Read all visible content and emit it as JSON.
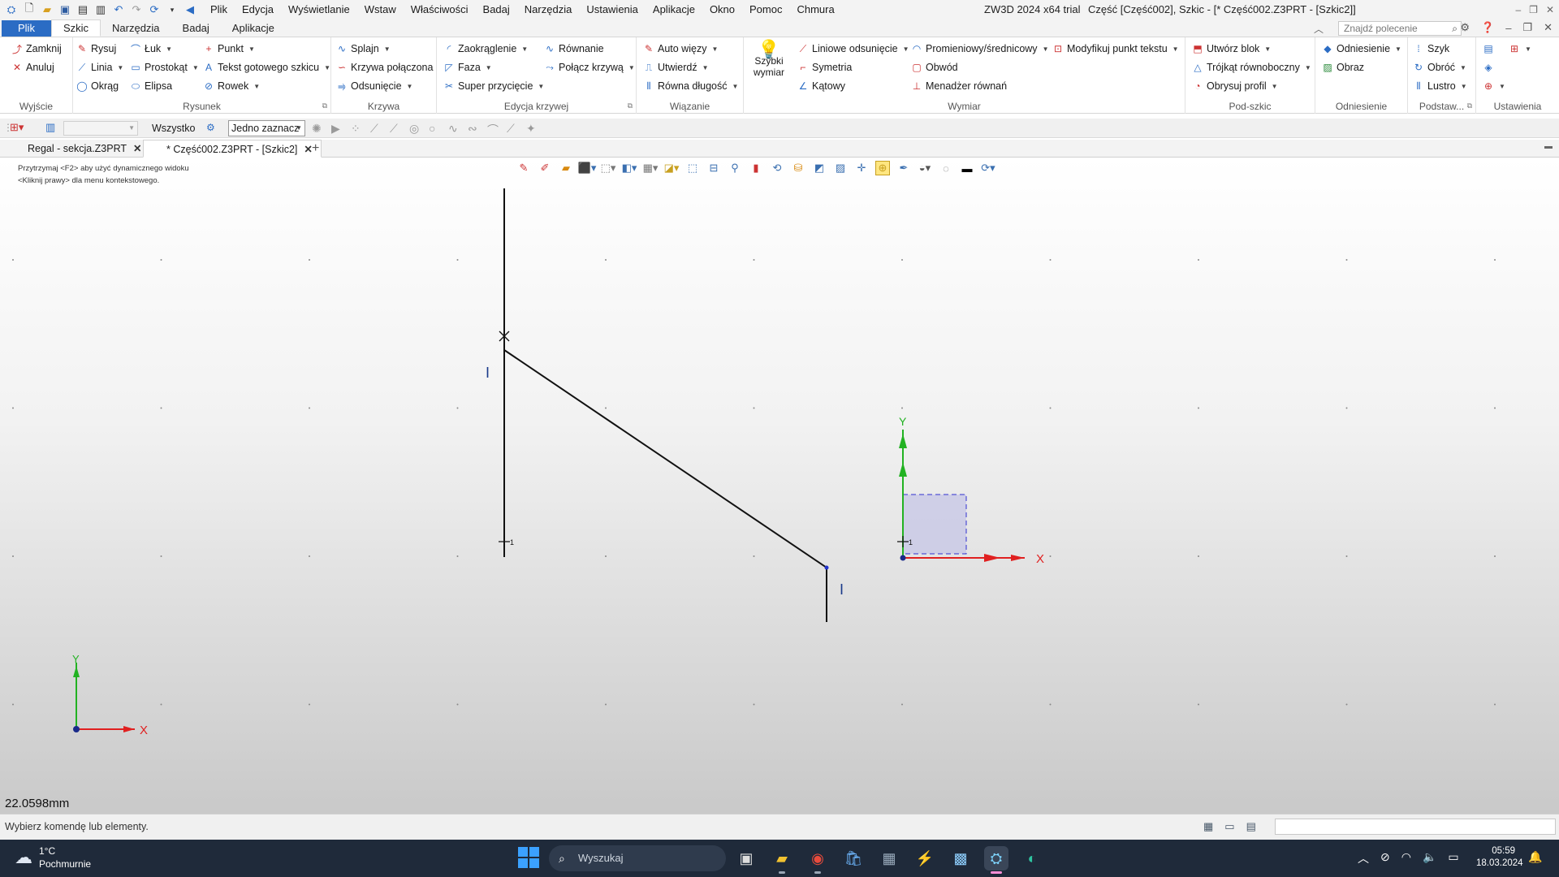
{
  "titlebar": {
    "menus": [
      "Plik",
      "Edycja",
      "Wyświetlanie",
      "Wstaw",
      "Właściwości",
      "Badaj",
      "Narzędzia",
      "Ustawienia",
      "Aplikacje",
      "Okno",
      "Pomoc",
      "Chmura"
    ],
    "app_title": "ZW3D 2024 x64 trial",
    "doc_title": "Część [Część002],  Szkic - [* Część002.Z3PRT - [Szkic2]]"
  },
  "ribbon_tabs": [
    "Plik",
    "Szkic",
    "Narzędzia",
    "Badaj",
    "Aplikacje"
  ],
  "search": {
    "placeholder": "Znajdź polecenie"
  },
  "ribbon": {
    "wyjscie": {
      "title": "Wyjście",
      "zamknij": "Zamknij",
      "anuluj": "Anuluj"
    },
    "rysunek": {
      "title": "Rysunek",
      "rysuj": "Rysuj",
      "linia": "Linia",
      "okrag": "Okrąg",
      "luk": "Łuk",
      "prostokat": "Prostokąt",
      "elipsa": "Elipsa",
      "punkt": "Punkt",
      "tekst": "Tekst gotowego szkicu",
      "rowek": "Rowek"
    },
    "krzywa": {
      "title": "Krzywa",
      "splajn": "Splajn",
      "krzywa_polaczona": "Krzywa połączona",
      "odsuniecie": "Odsunięcie"
    },
    "edycja": {
      "title": "Edycja krzywej",
      "zaokraglenie": "Zaokrąglenie",
      "faza": "Faza",
      "super": "Super przycięcie",
      "rownanie": "Równanie",
      "polacz": "Połącz krzywą"
    },
    "wiazanie": {
      "title": "Wiązanie",
      "auto": "Auto więzy",
      "utwierdz": "Utwierdź",
      "rowna": "Równa długość"
    },
    "wymiar": {
      "title": "Wymiar",
      "szybki_1": "Szybki",
      "szybki_2": "wymiar",
      "liniowe": "Liniowe odsunięcie",
      "symetria": "Symetria",
      "katowy": "Kątowy",
      "promieniowy": "Promieniowy/średnicowy",
      "obwod": "Obwód",
      "menadzer": "Menadżer równań",
      "modyfikuj": "Modyfikuj punkt tekstu"
    },
    "podszkic": {
      "title": "Pod-szkic",
      "utworz": "Utwórz blok",
      "trojkat": "Trójkąt równoboczny",
      "obrysuj": "Obrysuj profil"
    },
    "odniesienie": {
      "title": "Odniesienie",
      "odniesienie": "Odniesienie",
      "obraz": "Obraz"
    },
    "podstaw": {
      "title": "Podstaw...",
      "szyk": "Szyk",
      "obroc": "Obróć",
      "lustro": "Lustro"
    },
    "ustawienia": {
      "title": "Ustawienia"
    }
  },
  "toolbar2": {
    "filter_all": "Wszystko",
    "selection_mode": "Jedno zaznacz"
  },
  "doc_tabs": [
    {
      "label": "Regal - sekcja.Z3PRT"
    },
    {
      "label": "* Część002.Z3PRT - [Szkic2]"
    }
  ],
  "canvas": {
    "hint_1": "Przytrzymaj <F2> aby użyć dynamicznego widoku",
    "hint_2": "<Kliknij prawy> dla menu kontekstowego.",
    "measure": "22.0598mm",
    "axis_x": "X",
    "axis_y": "Y",
    "constraint_mark": "I",
    "origin_sub": "1"
  },
  "status": {
    "text": "Wybierz komendę lub elementy."
  },
  "taskbar": {
    "temp": "1°C",
    "weather": "Pochmurnie",
    "search": "Wyszukaj",
    "time": "05:59",
    "date": "18.03.2024"
  },
  "colors": {
    "accent": "#2b6cc4",
    "axis_x": "#e02020",
    "axis_y": "#22b222",
    "workplane_fill": "#c8c8e6",
    "workplane_border": "#3030d0"
  }
}
